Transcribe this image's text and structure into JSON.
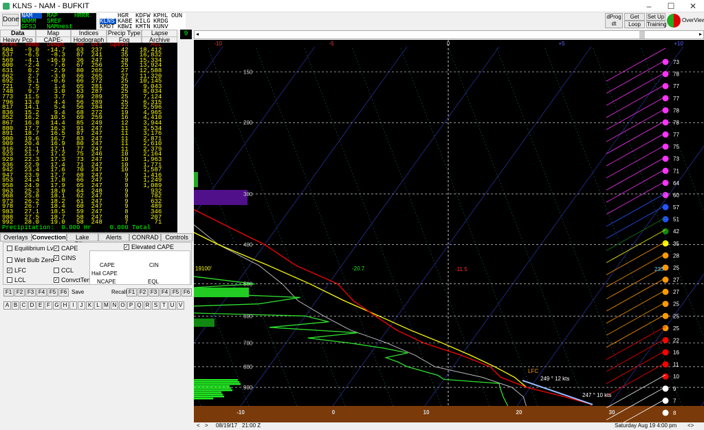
{
  "window": {
    "title": "KLNS - NAM - BUFKIT",
    "minimize": "–",
    "maximize": "☐",
    "close": "✕"
  },
  "toolbar": {
    "done": "Done",
    "dprog": "dProg dt",
    "get_data": "Get Data",
    "loop": "Loop",
    "set_up": "Set Up",
    "training": "Training",
    "overview": "OverView",
    "frame_number": "9"
  },
  "models": [
    {
      "label": "NAM",
      "color": "#ffffff",
      "bg": "#0050c8"
    },
    {
      "label": "RAP",
      "color": "#00ff00"
    },
    {
      "label": "HRRR",
      "color": "#00ff00"
    },
    {
      "label": "NAMM",
      "color": "#00ff00"
    },
    {
      "label": "SREF",
      "color": "#00ff00"
    },
    {
      "label": "GFS3",
      "color": "#00ff00"
    },
    {
      "label": "NAMnest",
      "color": "#00ff00"
    }
  ],
  "stations": [
    [
      "HGR",
      "KDFW",
      "KPHL",
      "OUN"
    ],
    [
      "KLNS",
      "KABE",
      "KILG",
      "KRDG"
    ],
    [
      "KMDT",
      "KBWI",
      "KMTN",
      "KUNV"
    ]
  ],
  "nav_tabs_row1": [
    "Data",
    "Map",
    "Indices",
    "Precip Type",
    "Lapse Rates"
  ],
  "nav_tabs_row2": [
    "Heavy Pcp",
    "CAPE-Shear",
    "Hodograph",
    "Fog",
    "Archive"
  ],
  "table": {
    "headers": [
      "Pres",
      "Temp",
      "Dewpt",
      "RH",
      "Dir",
      "Speed",
      "AGL"
    ],
    "rows": [
      [
        "504",
        "-9.0",
        "-14.7",
        "63",
        "237",
        "42",
        "18,412"
      ],
      [
        "537",
        "-6.5",
        "-8.3",
        "87",
        "241",
        "35",
        "16,832"
      ],
      [
        "569",
        "-4.1",
        "-16.9",
        "36",
        "247",
        "28",
        "15,334"
      ],
      [
        "600",
        "-2.4",
        "-7.6",
        "67",
        "256",
        "25",
        "13,924"
      ],
      [
        "631",
        "0.2",
        "-2.9",
        "80",
        "265",
        "27",
        "12,588"
      ],
      [
        "662",
        "2.7",
        "-3.0",
        "66",
        "265",
        "27",
        "11,320"
      ],
      [
        "692",
        "5.1",
        "-0.6",
        "66",
        "272",
        "25",
        "10,145"
      ],
      [
        "721",
        "7.5",
        "1.4",
        "65",
        "281",
        "25",
        "9,043"
      ],
      [
        "748",
        "9.7",
        "3.0",
        "63",
        "287",
        "25",
        "8,034"
      ],
      [
        "773",
        "11.5",
        "3.7",
        "59",
        "289",
        "25",
        "7,124"
      ],
      [
        "796",
        "13.0",
        "4.4",
        "56",
        "289",
        "25",
        "6,315"
      ],
      [
        "817",
        "14.1",
        "5.4",
        "56",
        "284",
        "22",
        "5,596"
      ],
      [
        "836",
        "15.2",
        "9.4",
        "68",
        "272",
        "19",
        "4,965"
      ],
      [
        "852",
        "16.2",
        "10.5",
        "69",
        "259",
        "16",
        "4,410"
      ],
      [
        "867",
        "16.8",
        "14.4",
        "85",
        "249",
        "12",
        "3,944"
      ],
      [
        "880",
        "17.7",
        "16.3",
        "91",
        "247",
        "11",
        "3,534"
      ],
      [
        "891",
        "18.7",
        "16.5",
        "87",
        "247",
        "11",
        "3,176"
      ],
      [
        "900",
        "19.6",
        "16.7",
        "83",
        "247",
        "11",
        "2,871"
      ],
      [
        "909",
        "20.4",
        "16.9",
        "80",
        "247",
        "11",
        "2,610"
      ],
      [
        "916",
        "21.1",
        "17.1",
        "77",
        "247",
        "11",
        "2,379"
      ],
      [
        "923",
        "21.7",
        "17.2",
        "75",
        "246",
        "10",
        "2,164"
      ],
      [
        "929",
        "22.3",
        "17.3",
        "73",
        "247",
        "10",
        "1,963"
      ],
      [
        "936",
        "22.9",
        "17.4",
        "71",
        "247",
        "10",
        "1,771"
      ],
      [
        "942",
        "23.4",
        "17.6",
        "70",
        "247",
        "10",
        "1,587"
      ],
      [
        "947",
        "23.9",
        "17.7",
        "68",
        "247",
        "9",
        "1,416"
      ],
      [
        "953",
        "24.4",
        "17.8",
        "66",
        "247",
        "9",
        "1,249"
      ],
      [
        "958",
        "24.9",
        "17.9",
        "65",
        "247",
        "9",
        "1,089"
      ],
      [
        "963",
        "25.3",
        "18.0",
        "64",
        "248",
        "9",
        "932"
      ],
      [
        "968",
        "25.8",
        "18.1",
        "62",
        "247",
        "9",
        "782"
      ],
      [
        "973",
        "26.2",
        "18.2",
        "61",
        "247",
        "9",
        "632"
      ],
      [
        "978",
        "26.7",
        "18.4",
        "60",
        "247",
        "9",
        "489"
      ],
      [
        "983",
        "27.1",
        "18.5",
        "59",
        "247",
        "8",
        "346"
      ],
      [
        "988",
        "27.5",
        "18.7",
        "58",
        "247",
        "8",
        "207"
      ],
      [
        "992",
        "28.0",
        "19.0",
        "58",
        "248",
        "7",
        "71"
      ]
    ],
    "precip_text": "Precipitation:  0.000 Hr     0.000 Total"
  },
  "bottom_tabs": [
    "Overlays",
    "Convection",
    "Lake Effect",
    "Alerts",
    "CONRAD",
    "Controls"
  ],
  "convection": {
    "checks": [
      {
        "label": "Equilibrium Lvl",
        "checked": false
      },
      {
        "label": "CAPE",
        "checked": true
      },
      {
        "label": "Wet Bulb Zero",
        "checked": false
      },
      {
        "label": "CINS",
        "checked": true
      },
      {
        "label": "LFC",
        "checked": true
      },
      {
        "label": "CCL",
        "checked": false
      },
      {
        "label": "LCL",
        "checked": false
      },
      {
        "label": "ConvctTemp",
        "checked": true
      },
      {
        "label": "Elevated CAPE",
        "checked": true
      }
    ],
    "labels": [
      "CAPE",
      "CIN",
      "Hail CAPE",
      "NCAPE",
      "EQL"
    ]
  },
  "fkeys": [
    "F1",
    "F2",
    "F3",
    "F4",
    "F5",
    "F6"
  ],
  "save_label": "Save",
  "recall_label": "Recall",
  "letters": [
    "A",
    "B",
    "C",
    "D",
    "E",
    "F",
    "G",
    "H",
    "I",
    "J",
    "K",
    "L",
    "M",
    "N",
    "O",
    "P",
    "Q",
    "R",
    "S",
    "T",
    "U",
    "V"
  ],
  "plot": {
    "top_scale": [
      "-10",
      "-5",
      "0",
      "+5",
      "+10"
    ],
    "pressures": [
      "150",
      "200",
      "300",
      "400",
      "500",
      "600",
      "700",
      "800",
      "900"
    ],
    "temps": [
      "-10",
      "0",
      "10",
      "20",
      "30"
    ],
    "annot": {
      "left_level": "19100'",
      "wb": "-20.7",
      "dcape": "-11.5",
      "lfc": "LFC",
      "wind1": "249 ° 12 kts",
      "wind2": "247 ° 10 kts",
      "cape_val": "233"
    },
    "right_numbers": [
      "73",
      "78",
      "77",
      "77",
      "78",
      "78",
      "77",
      "75",
      "73",
      "71",
      "64",
      "60",
      "57",
      "51",
      "42",
      "35",
      "28",
      "25",
      "27",
      "27",
      "25",
      "25",
      "25",
      "22",
      "16",
      "11",
      "10",
      "9",
      "7",
      "8"
    ]
  },
  "status": {
    "left": "08/19/17",
    "left2": "21:00 Z",
    "right": "Saturday  Aug 19  4:00 pm"
  }
}
